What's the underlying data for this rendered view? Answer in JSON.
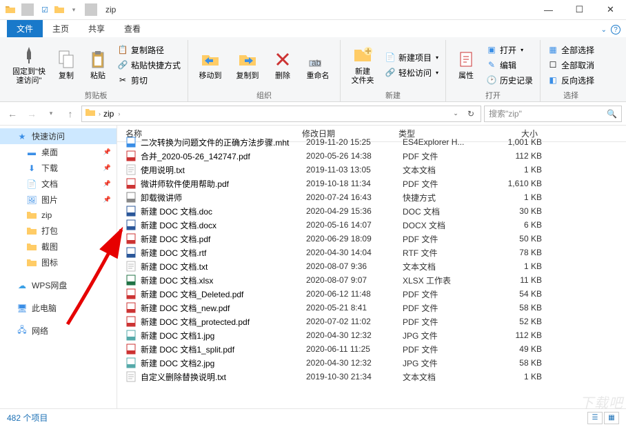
{
  "title": "zip",
  "tabs": [
    "文件",
    "主页",
    "共享",
    "查看"
  ],
  "ribbon": {
    "pin": "固定到\"快\n速访问\"",
    "copy": "复制",
    "paste": "粘贴",
    "copy_path": "复制路径",
    "paste_shortcut": "粘贴快捷方式",
    "cut": "剪切",
    "group_clipboard": "剪贴板",
    "move_to": "移动到",
    "copy_to": "复制到",
    "delete": "删除",
    "rename": "重命名",
    "group_organize": "组织",
    "new_folder": "新建\n文件夹",
    "new_item": "新建项目",
    "easy_access": "轻松访问",
    "group_new": "新建",
    "properties": "属性",
    "open": "打开",
    "edit": "编辑",
    "history": "历史记录",
    "group_open": "打开",
    "select_all": "全部选择",
    "deselect_all": "全部取消",
    "invert_selection": "反向选择",
    "group_select": "选择"
  },
  "address": {
    "crumb1": "zip",
    "sep": "›"
  },
  "search_placeholder": "搜索\"zip\"",
  "columns": {
    "name": "名称",
    "date": "修改日期",
    "type": "类型",
    "size": "大小"
  },
  "sidebar": {
    "quick": "快速访问",
    "desktop": "桌面",
    "downloads": "下载",
    "documents": "文档",
    "pictures": "图片",
    "zip": "zip",
    "dapao": "打包",
    "jietu": "截图",
    "tubiao": "图标",
    "wps": "WPS网盘",
    "thispc": "此电脑",
    "network": "网络"
  },
  "files": [
    {
      "icon": "mht",
      "name": "二次转换为问题文件的正确方法步骤.mht",
      "date": "2019-11-20 15:25",
      "type": "ES4Explorer H...",
      "size": "1,001 KB"
    },
    {
      "icon": "pdf",
      "name": "合并_2020-05-26_142747.pdf",
      "date": "2020-05-26 14:38",
      "type": "PDF 文件",
      "size": "112 KB"
    },
    {
      "icon": "txt",
      "name": "使用说明.txt",
      "date": "2019-11-03 13:05",
      "type": "文本文档",
      "size": "1 KB"
    },
    {
      "icon": "pdf",
      "name": "微讲师软件使用帮助.pdf",
      "date": "2019-10-18 11:34",
      "type": "PDF 文件",
      "size": "1,610 KB"
    },
    {
      "icon": "lnk",
      "name": "卸载微讲师",
      "date": "2020-07-24 16:43",
      "type": "快捷方式",
      "size": "1 KB"
    },
    {
      "icon": "doc",
      "name": "新建 DOC 文档.doc",
      "date": "2020-04-29 15:36",
      "type": "DOC 文档",
      "size": "30 KB"
    },
    {
      "icon": "doc",
      "name": "新建 DOC 文档.docx",
      "date": "2020-05-16 14:07",
      "type": "DOCX 文档",
      "size": "6 KB"
    },
    {
      "icon": "pdf",
      "name": "新建 DOC 文档.pdf",
      "date": "2020-06-29 18:09",
      "type": "PDF 文件",
      "size": "50 KB"
    },
    {
      "icon": "rtf",
      "name": "新建 DOC 文档.rtf",
      "date": "2020-04-30 14:04",
      "type": "RTF 文件",
      "size": "78 KB"
    },
    {
      "icon": "txt",
      "name": "新建 DOC 文档.txt",
      "date": "2020-08-07 9:36",
      "type": "文本文档",
      "size": "1 KB"
    },
    {
      "icon": "xls",
      "name": "新建 DOC 文档.xlsx",
      "date": "2020-08-07 9:07",
      "type": "XLSX 工作表",
      "size": "11 KB"
    },
    {
      "icon": "pdf",
      "name": "新建 DOC 文档_Deleted.pdf",
      "date": "2020-06-12 11:48",
      "type": "PDF 文件",
      "size": "54 KB"
    },
    {
      "icon": "pdf",
      "name": "新建 DOC 文档_new.pdf",
      "date": "2020-05-21 8:41",
      "type": "PDF 文件",
      "size": "58 KB"
    },
    {
      "icon": "pdf",
      "name": "新建 DOC 文档_protected.pdf",
      "date": "2020-07-02 11:02",
      "type": "PDF 文件",
      "size": "52 KB"
    },
    {
      "icon": "jpg",
      "name": "新建 DOC 文档1.jpg",
      "date": "2020-04-30 12:32",
      "type": "JPG 文件",
      "size": "112 KB"
    },
    {
      "icon": "pdf",
      "name": "新建 DOC 文档1_split.pdf",
      "date": "2020-06-11 11:25",
      "type": "PDF 文件",
      "size": "49 KB"
    },
    {
      "icon": "jpg",
      "name": "新建 DOC 文档2.jpg",
      "date": "2020-04-30 12:32",
      "type": "JPG 文件",
      "size": "58 KB"
    },
    {
      "icon": "txt",
      "name": "自定义删除替换说明.txt",
      "date": "2019-10-30 21:34",
      "type": "文本文档",
      "size": "1 KB"
    }
  ],
  "status": "482 个项目"
}
